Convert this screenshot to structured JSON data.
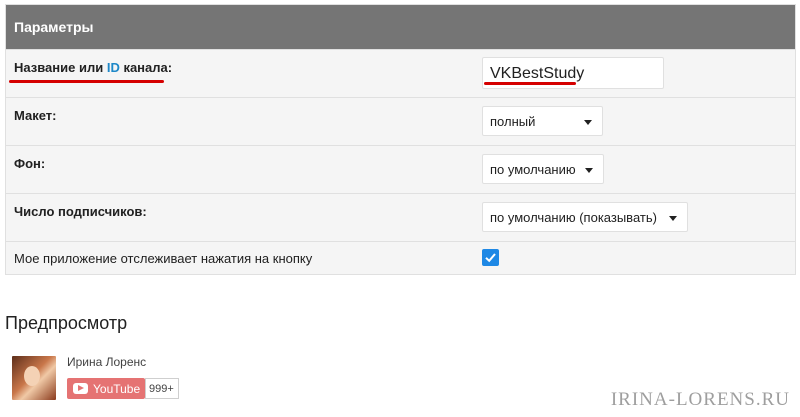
{
  "panel": {
    "header": "Параметры",
    "rows": {
      "channel": {
        "label_before": "Название или ",
        "label_hl": "ID",
        "label_after": " канала:",
        "value": "VKBestStudy"
      },
      "layout": {
        "label": "Макет:",
        "selected": "полный"
      },
      "theme": {
        "label": "Фон:",
        "selected": "по умолчанию"
      },
      "subscribers": {
        "label": "Число подписчиков:",
        "selected": "по умолчанию (показывать)"
      },
      "tracking": {
        "label": "Мое приложение отслеживает нажатия на кнопку",
        "checked": true
      }
    }
  },
  "preview": {
    "title": "Предпросмотр",
    "channel_name": "Ирина Лоренс",
    "button_label": "YouTube",
    "subscriber_count": "999+"
  },
  "watermark": "IRINA-LORENS.RU",
  "colors": {
    "header_bg": "#757575",
    "row_bg": "#f5f5f5",
    "accent": "#1e88e5",
    "underline": "#d50000",
    "youtube_button": "#e57373"
  }
}
